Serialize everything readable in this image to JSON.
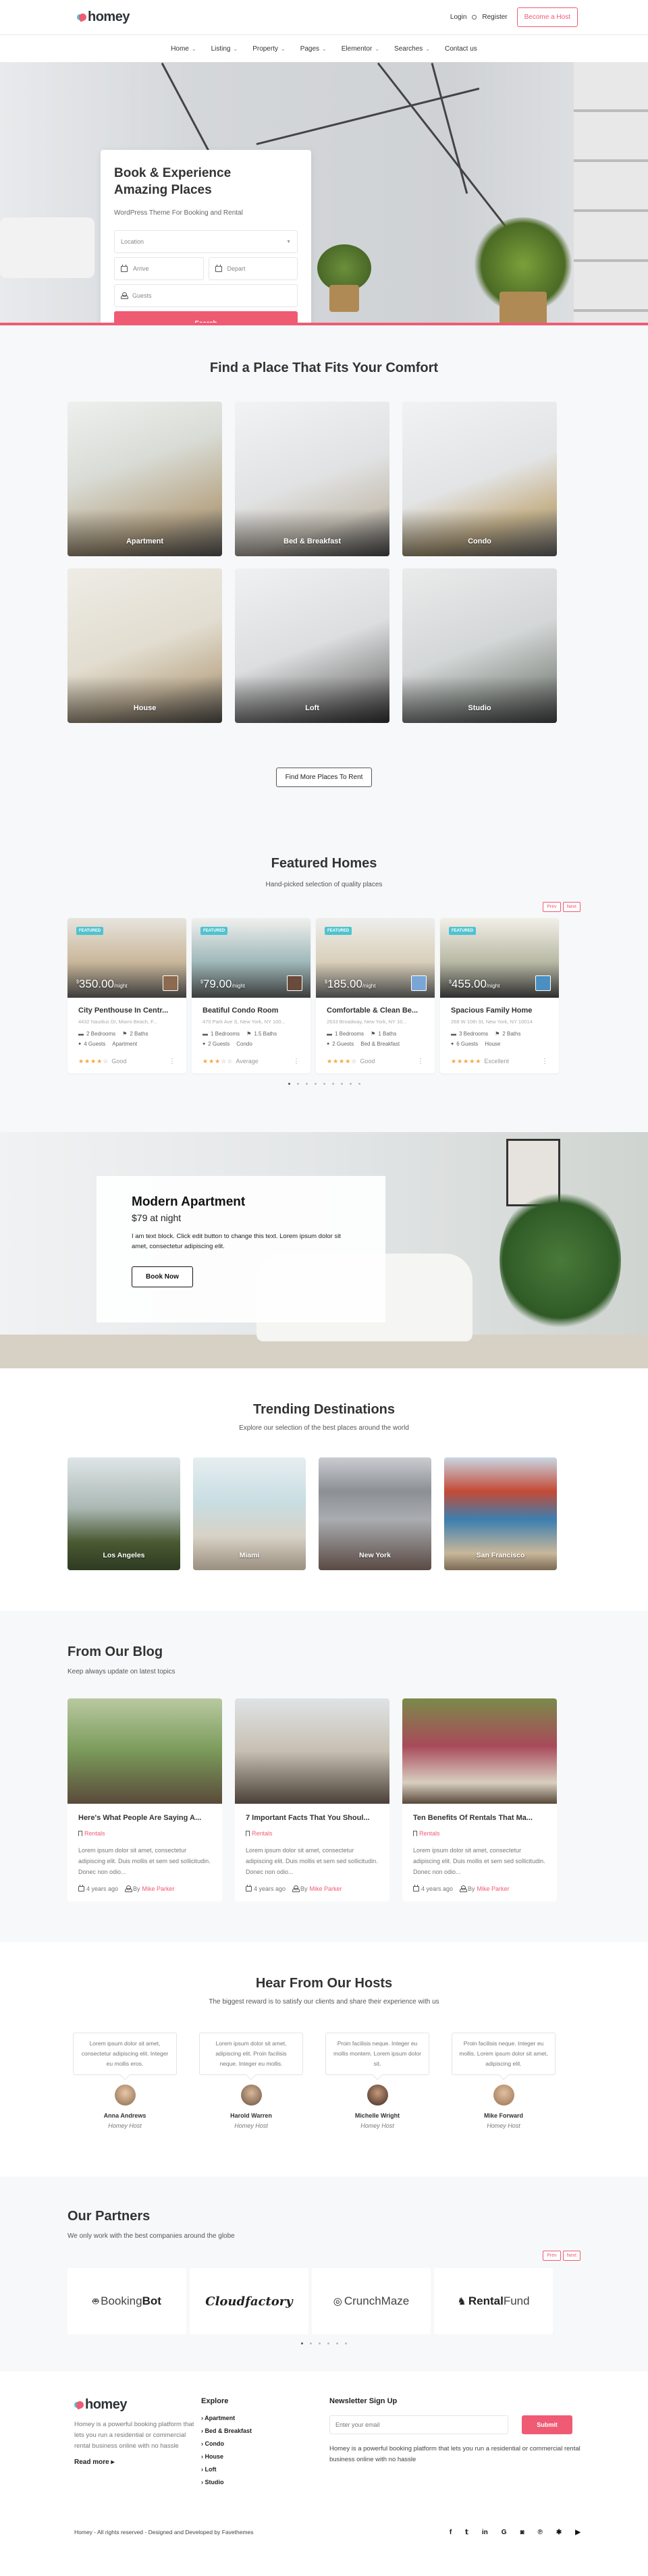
{
  "header": {
    "logo_text": "homey",
    "login": "Login",
    "register": "Register",
    "become_host": "Become a Host",
    "nav": [
      {
        "label": "Home",
        "has_dropdown": true
      },
      {
        "label": "Listing",
        "has_dropdown": true
      },
      {
        "label": "Property",
        "has_dropdown": true
      },
      {
        "label": "Pages",
        "has_dropdown": true
      },
      {
        "label": "Elementor",
        "has_dropdown": true
      },
      {
        "label": "Searches",
        "has_dropdown": true
      },
      {
        "label": "Contact us",
        "has_dropdown": false
      }
    ]
  },
  "hero": {
    "title_line1": "Book & Experience",
    "title_line2": "Amazing Places",
    "subtitle": "WordPress Theme For Booking and Rental",
    "location_placeholder": "Location",
    "arrive_placeholder": "Arrive",
    "depart_placeholder": "Depart",
    "guests_placeholder": "Guests",
    "search_button": "Search"
  },
  "categories": {
    "title": "Find a Place That Fits Your Comfort",
    "items": [
      "Apartment",
      "Bed & Breakfast",
      "Condo",
      "House",
      "Loft",
      "Studio"
    ],
    "more_button": "Find More Places To Rent"
  },
  "featured": {
    "title": "Featured Homes",
    "subtitle": "Hand-picked selection of quality places",
    "prev": "Prev",
    "next": "Next",
    "badge": "FEATURED",
    "per": "/night",
    "listings": [
      {
        "price": "350.00",
        "title": "City Penthouse In Centr...",
        "address": "4432 Nautilus Dr, Miami Beach, F...",
        "bedrooms": "2 Bedrooms",
        "baths": "2 Baths",
        "guests": "4 Guests",
        "type": "Apartment",
        "rating": 4,
        "rating_word": "Good"
      },
      {
        "price": "79.00",
        "title": "Beatiful Condo Room",
        "address": "470 Park Ave S, New York, NY 100...",
        "bedrooms": "1 Bedrooms",
        "baths": "1.5 Baths",
        "guests": "2 Guests",
        "type": "Condo",
        "rating": 3,
        "rating_word": "Average"
      },
      {
        "price": "185.00",
        "title": "Comfortable & Clean Be...",
        "address": "2633 Broadway, New York, NY 10...",
        "bedrooms": "1 Bedrooms",
        "baths": "1 Baths",
        "guests": "2 Guests",
        "type": "Bed & Breakfast",
        "rating": 4,
        "rating_word": "Good"
      },
      {
        "price": "455.00",
        "title": "Spacious Family Home",
        "address": "268 W 10th St, New York, NY 10014",
        "bedrooms": "3 Bedrooms",
        "baths": "2 Baths",
        "guests": "6 Guests",
        "type": "House",
        "rating": 5,
        "rating_word": "Excellent"
      }
    ],
    "page_count": 9,
    "active_page": 1
  },
  "promo": {
    "title": "Modern Apartment",
    "price": "$79 at night",
    "text": "I am text block. Click edit button to change this text. Lorem ipsum dolor sit amet, consectetur adipiscing elit.",
    "button": "Book Now"
  },
  "destinations": {
    "title": "Trending Destinations",
    "subtitle": "Explore our selection of the best places around the world",
    "items": [
      "Los Angeles",
      "Miami",
      "New York",
      "San Francisco"
    ]
  },
  "blog": {
    "title": "From Our Blog",
    "subtitle": "Keep always update on latest topics",
    "posts": [
      {
        "title": "Here's What People Are Saying A...",
        "category": "Rentals",
        "excerpt": "Lorem ipsum dolor sit amet, consectetur adipiscing elit. Duis mollis et sem sed sollicitudin. Donec non odio...",
        "date": "4 years ago",
        "by": "By",
        "author": "Mike Parker"
      },
      {
        "title": "7 Important Facts That You Shoul...",
        "category": "Rentals",
        "excerpt": "Lorem ipsum dolor sit amet, consectetur adipiscing elit. Duis mollis et sem sed sollicitudin. Donec non odio...",
        "date": "4 years ago",
        "by": "By",
        "author": "Mike Parker"
      },
      {
        "title": "Ten Benefits Of Rentals That Ma...",
        "category": "Rentals",
        "excerpt": "Lorem ipsum dolor sit amet, consectetur adipiscing elit. Duis mollis et sem sed sollicitudin. Donec non odio...",
        "date": "4 years ago",
        "by": "By",
        "author": "Mike Parker"
      }
    ]
  },
  "hosts": {
    "title": "Hear From Our Hosts",
    "subtitle": "The biggest reward is to satisfy our clients and share their experience with us",
    "items": [
      {
        "quote": "Lorem ipsum dolor sit amet, consectetur adipiscing elit. Integer eu mollis eros.",
        "name": "Anna Andrews",
        "role": "Homey Host"
      },
      {
        "quote": "Lorem ipsum dolor sit amet, adipiscing elit. Proin facilisis neque. Integer eu mollis.",
        "name": "Harold Warren",
        "role": "Homey Host"
      },
      {
        "quote": "Proin facilisis neque. Integer eu mollis montem. Lorem ipsum dolor sit.",
        "name": "Michelle Wright",
        "role": "Homey Host"
      },
      {
        "quote": "Proin facilisis neque. Integer eu mollis. Lorem ipsum dolor sit amet, adipiscing elit.",
        "name": "Mike Forward",
        "role": "Homey Host"
      }
    ]
  },
  "partners": {
    "title": "Our Partners",
    "subtitle": "We only work with the best companies around the globe",
    "prev": "Prev",
    "next": "Next",
    "logos": [
      {
        "light": "Booking",
        "bold": "Bot"
      },
      {
        "light": "",
        "bold": "Cloudfactory"
      },
      {
        "light": "CrunchMaze",
        "bold": ""
      },
      {
        "light": "Fund",
        "bold": "Rental"
      }
    ],
    "page_count": 6,
    "active_page": 1
  },
  "footer": {
    "logo_text": "homey",
    "about": "Homey is a powerful booking platform that lets you run a residential or commercial rental business online with no hassle",
    "read_more": "Read more",
    "explore_title": "Explore",
    "explore_links": [
      "Apartment",
      "Bed & Breakfast",
      "Condo",
      "House",
      "Loft",
      "Studio"
    ],
    "newsletter_title": "Newsletter Sign Up",
    "email_placeholder": "Enter your email",
    "submit": "Submit",
    "newsletter_text": "Homey is a powerful booking platform that lets you run a residential or commercial rental business online with no hassle",
    "copyright": "Homey - All rights reserved - Designed and Developed by Favethemes",
    "socials": [
      "facebook",
      "twitter",
      "linkedin",
      "google",
      "instagram",
      "pinterest",
      "yelp",
      "youtube"
    ]
  },
  "colors": {
    "accent": "#f05b74",
    "badge": "#4fc3d0",
    "star": "#f4a63c"
  }
}
